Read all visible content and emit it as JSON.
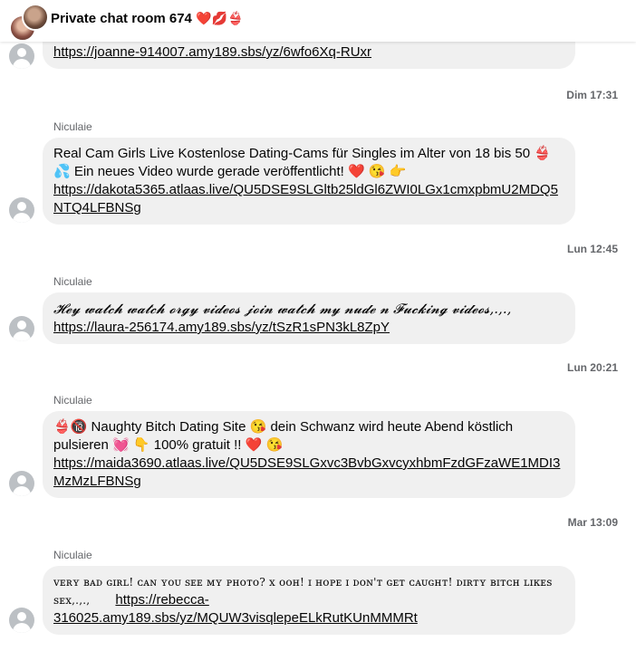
{
  "header": {
    "title": "Private chat room 674",
    "title_emojis": "❤️💋👙"
  },
  "messages": [
    {
      "link": "https://joanne-914007.amy189.sbs/yz/6wfo6Xq-RUxr"
    },
    {
      "timestamp": "Dim 17:31",
      "sender": "Niculaie",
      "text": "Real Cam Girls Live Kostenlose Dating-Cams für Singles im Alter von 18 bis 50 👙💦 Ein neues Video wurde gerade veröffentlicht! ❤️ 😘 👉",
      "link": "https://dakota5365.atlaas.live/QU5DSE9SLGltb25ldGl6ZWI0LGx1cmxpbmU2MDQ5NTQ4LFBNSg"
    },
    {
      "timestamp": "Lun 12:45",
      "sender": "Niculaie",
      "text": "𝓗𝓮𝔂 𝔀𝓪𝓽𝓬𝓱 𝔀𝓪𝓽𝓬𝓱 𝓸𝓻𝓰𝔂 𝓿𝓲𝓭𝓮𝓸𝓼 𝓳𝓸𝓲𝓷 𝔀𝓪𝓽𝓬𝓱 𝓶𝔂 𝓷𝓾𝓭𝓮 𝓷 𝓕𝓾𝓬𝓴𝓲𝓷𝓰 𝓿𝓲𝓭𝓮𝓸𝓼,.,.,",
      "link": "https://laura-256174.amy189.sbs/yz/tSzR1sPN3kL8ZpY"
    },
    {
      "timestamp": "Lun 20:21",
      "sender": "Niculaie",
      "text": "👙🔞 Naughty Bitch Dating Site 😘 dein Schwanz wird heute Abend köstlich pulsieren 💓 👇 100% gratuit !! ❤️ 😘",
      "link": "https://maida3690.atlaas.live/QU5DSE9SLGxvc3BvbGxvcyxhbmFzdGFzaWE1MDI3MzMzLFBNSg"
    },
    {
      "timestamp": "Mar 13:09",
      "sender": "Niculaie",
      "text": "ᴠᴇʀʏ ʙᴀᴅ ɢɪʀʟ! ᴄᴀɴ ʏᴏᴜ ꜱᴇᴇ ᴍʏ ᴘʜᴏᴛᴏ? x ᴏᴏʜ! ɪ ʜᴏᴘᴇ ɪ ᴅᴏɴ'ᴛ ɢᴇᴛ ᴄᴀᴜɢʜᴛ! ᴅɪʀᴛʏ ʙɪᴛᴄʜ ʟɪᴋᴇꜱ ꜱᴇx,.,.,",
      "link": "https://rebecca-316025.amy189.sbs/yz/MQUW3visqlepeELkRutKUnMMMRt"
    }
  ]
}
